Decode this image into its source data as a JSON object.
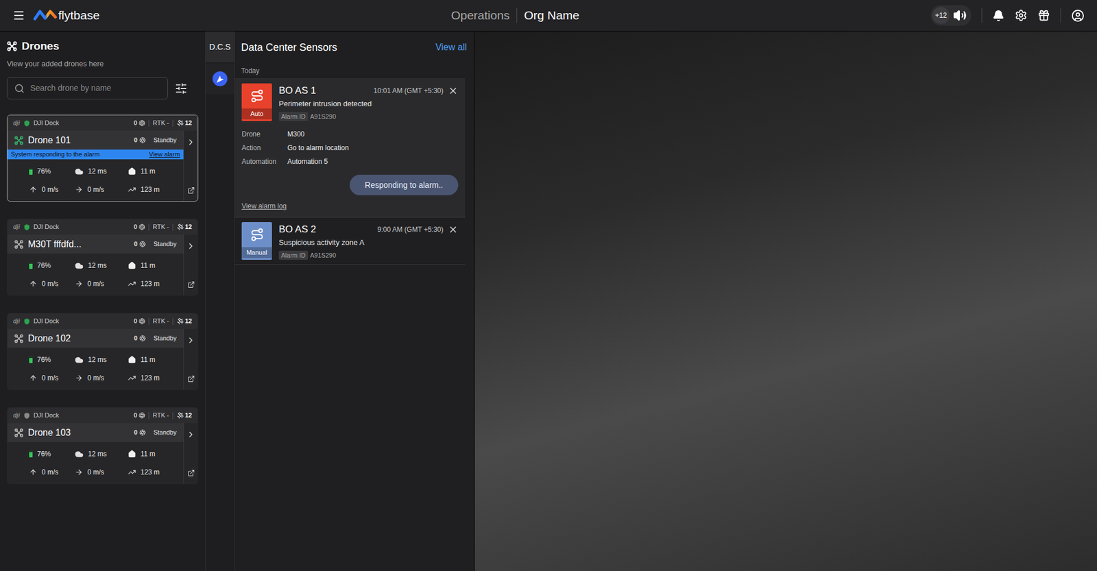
{
  "header": {
    "brand": "flytbase",
    "nav": "Operations",
    "org": "Org Name",
    "badge": "+12"
  },
  "drones_panel": {
    "title": "Drones",
    "subtitle": "View your added drones here",
    "search_placeholder": "Search drone by name"
  },
  "drones": [
    {
      "brand_mark": "dji",
      "dock": "DJI Dock",
      "dock_color": "#2ea44f",
      "dock_count": "0",
      "rtk": "RTK -",
      "satellites": "12",
      "name": "Drone 101",
      "active": true,
      "status_count": "0",
      "status": "Standby",
      "selected": true,
      "alarm": {
        "text": "System responding to the alarm",
        "link": "View alarm"
      },
      "battery": "76%",
      "battery_level": 0.76,
      "wind": "12 ms",
      "home": "11 m",
      "vspeed": "0 m/s",
      "hspeed": "0 m/s",
      "altitude": "123 m"
    },
    {
      "brand_mark": "dji",
      "dock": "DJI Dock",
      "dock_color": "#2ea44f",
      "dock_count": "0",
      "rtk": "RTK -",
      "satellites": "12",
      "name": "M30T fffdfd...",
      "active": false,
      "status_count": "0",
      "status": "Standby",
      "selected": false,
      "alarm": null,
      "battery": "76%",
      "battery_level": 0.76,
      "wind": "12 ms",
      "home": "11 m",
      "vspeed": "0 m/s",
      "hspeed": "0 m/s",
      "altitude": "123 m"
    },
    {
      "brand_mark": "dji",
      "dock": "DJI Dock",
      "dock_color": "#2ea44f",
      "dock_count": "0",
      "rtk": "RTK -",
      "satellites": "12",
      "name": "Drone 102",
      "active": false,
      "status_count": "0",
      "status": "Standby",
      "selected": false,
      "alarm": null,
      "battery": "76%",
      "battery_level": 0.76,
      "wind": "12 ms",
      "home": "11 m",
      "vspeed": "0 m/s",
      "hspeed": "0 m/s",
      "altitude": "123 m"
    },
    {
      "brand_mark": "dji",
      "dock": "DJI Dock",
      "dock_color": "#8a8a8a",
      "dock_count": "0",
      "rtk": "RTK -",
      "satellites": "12",
      "name": "Drone 103",
      "active": false,
      "status_count": "0",
      "status": "Standby",
      "selected": false,
      "alarm": null,
      "battery": "76%",
      "battery_level": 0.76,
      "wind": "12 ms",
      "home": "11 m",
      "vspeed": "0 m/s",
      "hspeed": "0 m/s",
      "altitude": "123 m"
    }
  ],
  "side_tabs": [
    {
      "label": "D.C.S",
      "selected": true
    }
  ],
  "sensors": {
    "title": "Data Center Sensors",
    "view_all": "View all",
    "group": "Today",
    "alarms": [
      {
        "name": "BO AS 1",
        "description": "Perimeter intrusion detected",
        "time": "10:01 AM (GMT +5:30)",
        "alarm_id_label": "Alarm ID",
        "alarm_id": "A91S290",
        "mode": "Auto",
        "color": "#e8412c",
        "expanded": true,
        "details": [
          {
            "label": "Drone",
            "value": "M300"
          },
          {
            "label": "Action",
            "value": "Go to alarm location"
          },
          {
            "label": "Automation",
            "value": "Automation 5"
          }
        ],
        "status_button": "Responding to alarm..",
        "log_link": "View alarm log"
      },
      {
        "name": "BO AS 2",
        "description": "Suspicious activity zone A",
        "time": "9:00 AM (GMT +5:30)",
        "alarm_id_label": "Alarm ID",
        "alarm_id": "A91S290",
        "mode": "Manual",
        "color": "#6d8fc9",
        "expanded": false,
        "details": [],
        "status_button": "",
        "log_link": ""
      }
    ]
  }
}
